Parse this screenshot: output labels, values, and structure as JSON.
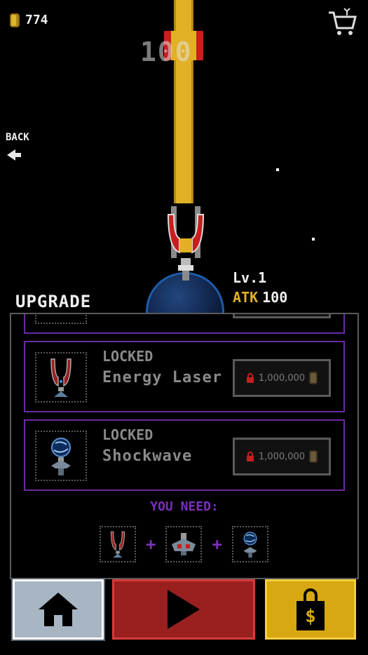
{
  "hud": {
    "coin_icon": "coin-icon",
    "coins": "774",
    "cart_icon": "shopping-cart-icon"
  },
  "navigation": {
    "back_label": "BACK",
    "back_icon": "left-arrow-icon"
  },
  "battle": {
    "damage_number": "100",
    "level": "Lv.1",
    "atk_label": "ATK",
    "atk_value": "100",
    "laser_color": "#e2b024",
    "planet_color": "#1e5ca8"
  },
  "upgrade": {
    "title": "UPGRADE",
    "items": [
      {
        "status": "LOCKED",
        "name": "Energy Laser",
        "price": "1,000,000",
        "icon": "energy-laser-turret-icon"
      },
      {
        "status": "LOCKED",
        "name": "Shockwave",
        "price": "1,000,000",
        "icon": "shockwave-turret-icon"
      }
    ],
    "you_need_label": "YOU NEED:",
    "requirements": [
      "energy-laser-turret-icon",
      "cannon-turret-icon",
      "shockwave-turret-icon"
    ],
    "plus_sign": "+",
    "accent_color": "#6a2aa0"
  },
  "bottom_bar": {
    "home_icon": "home-icon",
    "play_icon": "play-icon",
    "shop_icon": "shopping-bag-dollar-icon",
    "home_color": "#a8b6c4",
    "play_color": "#9a2020",
    "shop_color": "#d8a812"
  }
}
